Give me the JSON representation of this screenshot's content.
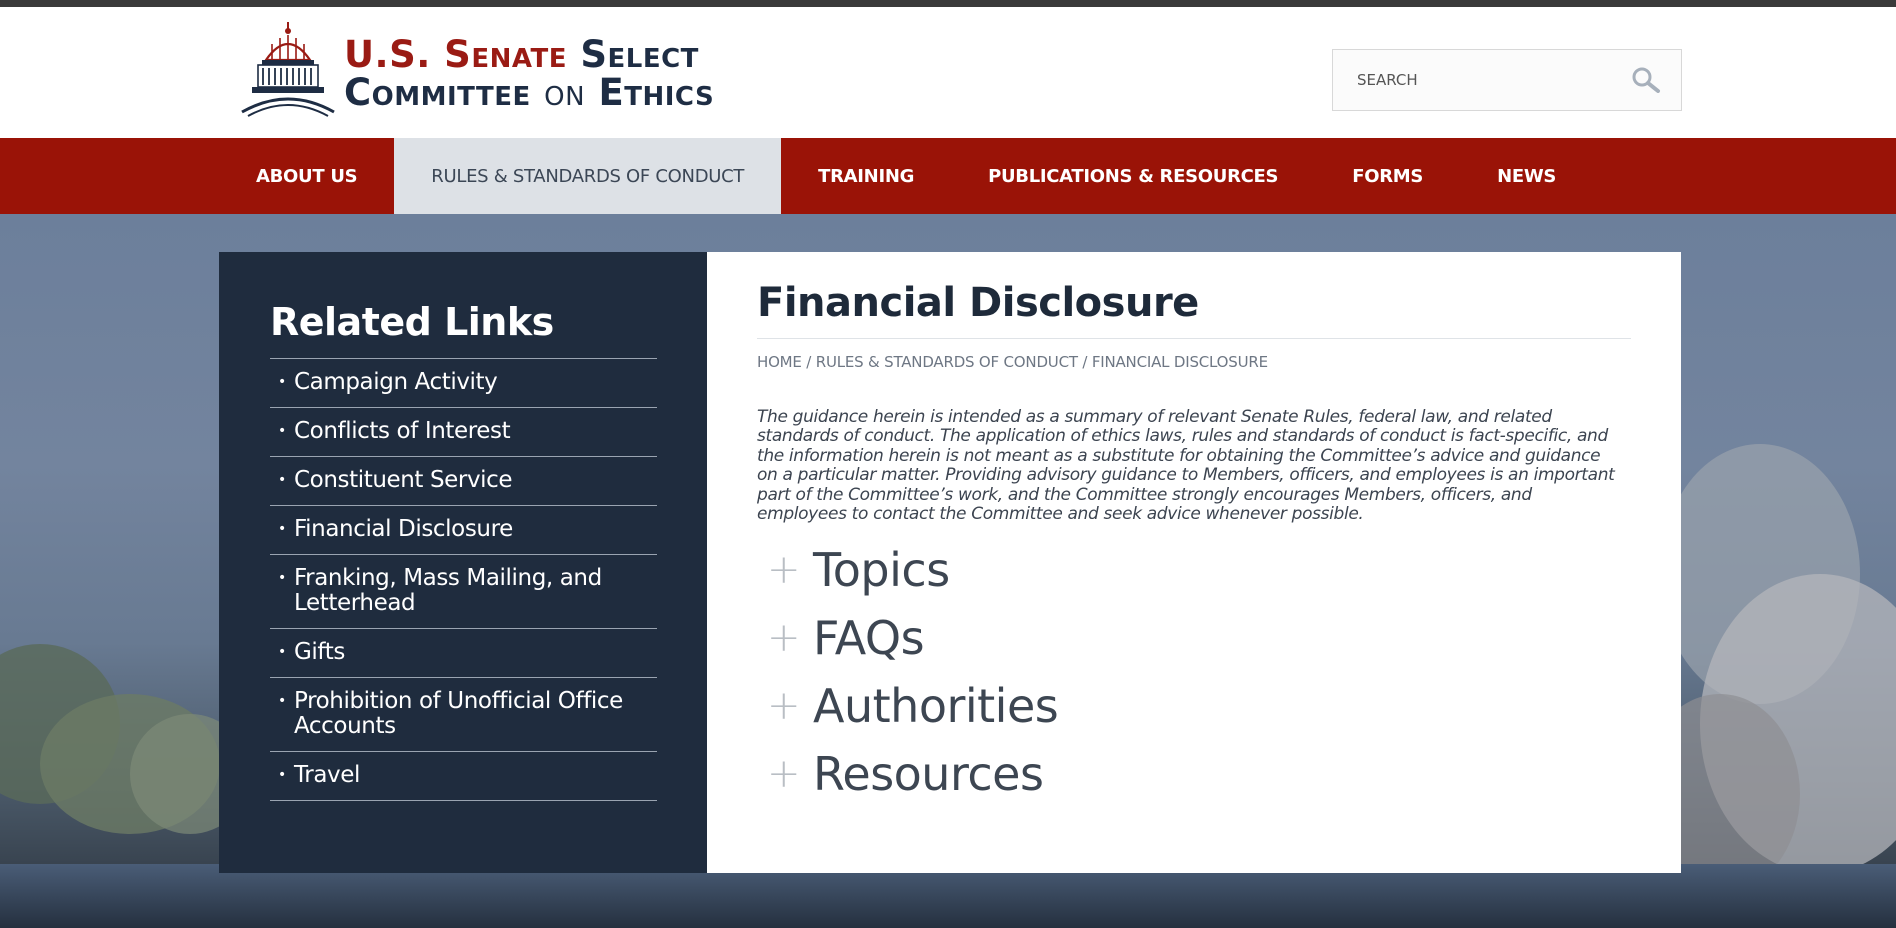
{
  "header": {
    "logo": {
      "line1_prefix": "U.S. Senate",
      "line1_suffix": "Select",
      "line2_prefix": "Committee",
      "line2_middle": "on",
      "line2_suffix": "Ethics"
    },
    "search": {
      "placeholder": "SEARCH",
      "value": "",
      "icon": "search-icon"
    }
  },
  "nav": {
    "items": [
      {
        "label": "ABOUT US",
        "active": false
      },
      {
        "label": "RULES & STANDARDS OF CONDUCT",
        "active": true
      },
      {
        "label": "TRAINING",
        "active": false
      },
      {
        "label": "PUBLICATIONS & RESOURCES",
        "active": false
      },
      {
        "label": "FORMS",
        "active": false
      },
      {
        "label": "NEWS",
        "active": false
      }
    ]
  },
  "sidebar": {
    "title": "Related Links",
    "items": [
      {
        "label": "Campaign Activity"
      },
      {
        "label": "Conflicts of Interest"
      },
      {
        "label": "Constituent Service"
      },
      {
        "label": "Financial Disclosure"
      },
      {
        "label": "Franking, Mass Mailing, and Letterhead"
      },
      {
        "label": "Gifts"
      },
      {
        "label": "Prohibition of Unofficial Office Accounts"
      },
      {
        "label": "Travel"
      }
    ]
  },
  "main": {
    "title": "Financial Disclosure",
    "breadcrumb": {
      "home": "HOME",
      "section": "RULES & STANDARDS OF CONDUCT",
      "current": "FINANCIAL DISCLOSURE",
      "separator": "/"
    },
    "intro": "The guidance herein is intended as a summary of relevant Senate Rules, federal law, and related standards of conduct. The application of ethics laws, rules and standards of conduct is fact-specific, and the information herein is not meant as a substitute for obtaining the Committee’s advice and guidance on a particular matter. Providing advisory guidance to Members, officers, and employees is an important part of the Committee’s work, and the Committee strongly encourages Members, officers, and employees to contact the Committee and seek advice whenever possible.",
    "accordion": [
      {
        "label": "Topics",
        "icon": "plus-icon"
      },
      {
        "label": "FAQs",
        "icon": "plus-icon"
      },
      {
        "label": "Authorities",
        "icon": "plus-icon"
      },
      {
        "label": "Resources",
        "icon": "plus-icon"
      }
    ]
  },
  "colors": {
    "nav_red": "#9a1307",
    "nav_active": "#dde1e6",
    "sidebar_navy": "#1f2c3e",
    "logo_red": "#9a1b14",
    "logo_navy": "#1e2d44"
  }
}
